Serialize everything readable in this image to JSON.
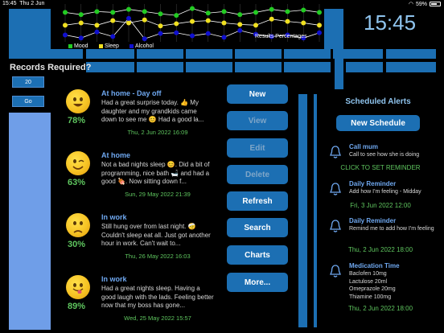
{
  "status_bar": {
    "time": "15:45",
    "date": "Thu 2 Jun",
    "battery": "59%"
  },
  "clock": "15:45",
  "chart": {
    "legend": [
      {
        "label": "Mood",
        "color": "#22cc22"
      },
      {
        "label": "Sleep",
        "color": "#f0e020"
      },
      {
        "label": "Alcohol",
        "color": "#1010d0"
      }
    ],
    "caption": "Results Percentages"
  },
  "chart_data": {
    "type": "line",
    "title": "",
    "series": [
      {
        "name": "Mood",
        "color": "#22cc22",
        "values": [
          78,
          72,
          80,
          78,
          86,
          80,
          74,
          70,
          88,
          76,
          80,
          72,
          78,
          86,
          80,
          84,
          78
        ]
      },
      {
        "name": "Sleep",
        "color": "#f0e020",
        "values": [
          44,
          50,
          44,
          56,
          50,
          58,
          42,
          48,
          54,
          56,
          50,
          46,
          44,
          60,
          54,
          50,
          44
        ]
      },
      {
        "name": "Alcohol",
        "color": "#1010d0",
        "values": [
          18,
          10,
          26,
          14,
          62,
          8,
          22,
          24,
          16,
          22,
          12,
          30,
          20,
          14,
          18,
          10,
          24
        ]
      }
    ],
    "ylim": [
      0,
      100
    ]
  },
  "left_panel": {
    "records_label": "Records Required?",
    "count_value": "20",
    "go_label": "Go"
  },
  "records": [
    {
      "title": "At home - Day off",
      "percent": "78%",
      "mood": "happy",
      "text": "Had a great surprise today. 👍 My daughter and my grandkids came down to see me 😊 Had a good la...",
      "date": "Thu, 2 Jun 2022 16:09"
    },
    {
      "title": "At home",
      "percent": "63%",
      "mood": "wink",
      "text": "Not a bad nights sleep 😊. Did a bit of programming, nice bath 🛁 and had a good 🍖. Now sitting down f...",
      "date": "Sun, 29 May 2022 21:39"
    },
    {
      "title": "In work",
      "percent": "30%",
      "mood": "sad",
      "text": "Still hung over from last night. 🤕 Couldn't sleep eat all. Just got another hour in work. Can't wait to...",
      "date": "Thu, 26 May 2022 16:03"
    },
    {
      "title": "In work",
      "percent": "89%",
      "mood": "tongue",
      "text": "Had a great nights sleep. Having a good laugh with the lads. Feeling better now that my boss has gone...",
      "date": "Wed, 25 May 2022 15:57"
    }
  ],
  "actions": [
    {
      "label": "New",
      "disabled": false
    },
    {
      "label": "View",
      "disabled": true
    },
    {
      "label": "Edit",
      "disabled": true
    },
    {
      "label": "Delete",
      "disabled": true
    },
    {
      "label": "Refresh",
      "disabled": false
    },
    {
      "label": "Search",
      "disabled": false
    },
    {
      "label": "Charts",
      "disabled": false
    },
    {
      "label": "More...",
      "disabled": false
    }
  ],
  "alerts_panel": {
    "title": "Scheduled Alerts",
    "new_schedule_label": "New Schedule",
    "alerts": [
      {
        "title": "Call mum",
        "body": "Call to see how she is doing",
        "footer": "CLICK TO SET REMINDER"
      },
      {
        "title": "Daily Reminder",
        "body": "Add how I'm feeling - Midday",
        "footer": "Fri, 3 Jun 2022 12:00"
      },
      {
        "title": "Daily Reminder",
        "body": "Remind me to add how I'm feeling",
        "footer": "Thu, 2 Jun 2022 18:00"
      },
      {
        "title": "Medication Time",
        "body": "Baclofen 10mg\nLactulose 20ml\nOmeprazole 20mg\nThiamine 100mg",
        "footer": "Thu, 2 Jun 2022 18:00"
      }
    ]
  }
}
